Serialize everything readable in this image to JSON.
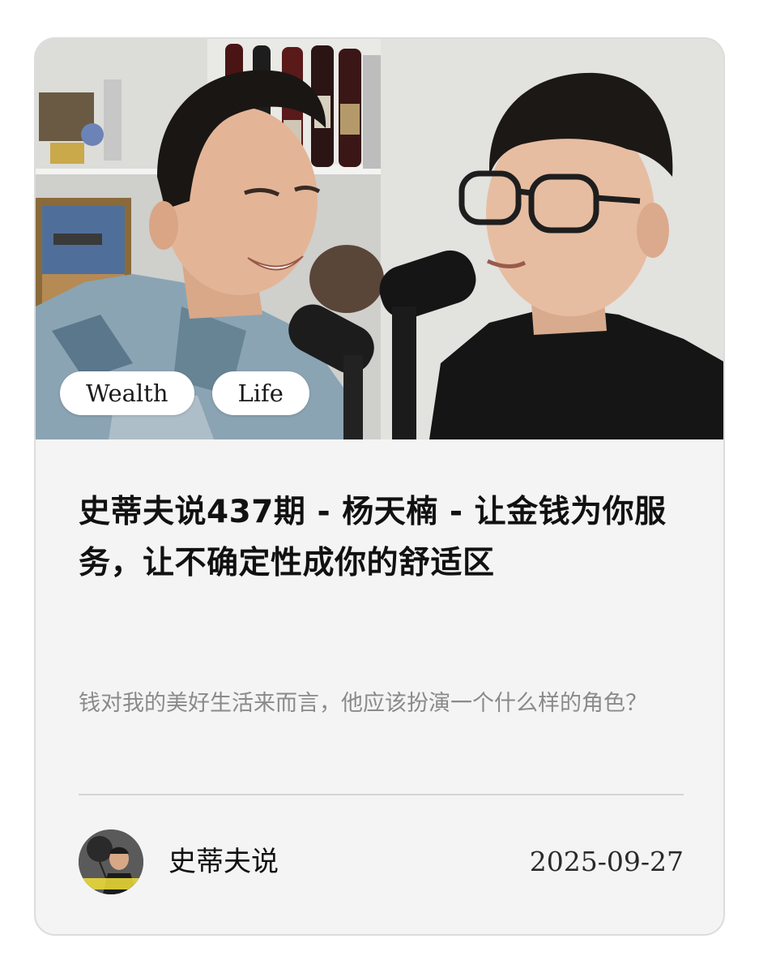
{
  "card": {
    "hero_alt": "Two men talking into podcast microphones",
    "tags": [
      "Wealth",
      "Life"
    ],
    "title": "史蒂夫说437期 - 杨天楠 - 让金钱为你服务，让不确定性成你的舒适区",
    "subtitle": "钱对我的美好生活来而言，他应该扮演一个什么样的角色？",
    "author": {
      "name": "史蒂夫说",
      "avatar_text": "史蒂夫说"
    },
    "date": "2025-09-27"
  }
}
